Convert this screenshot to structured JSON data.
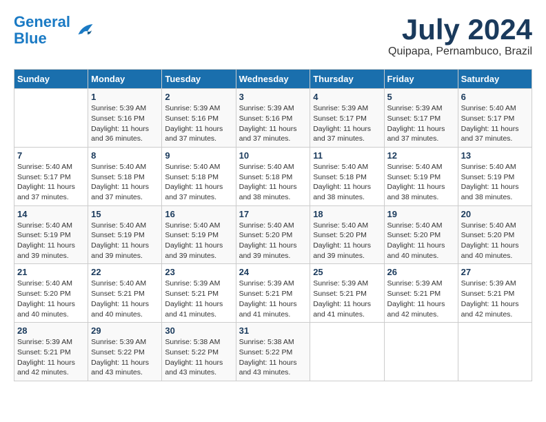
{
  "header": {
    "logo_line1": "General",
    "logo_line2": "Blue",
    "title": "July 2024",
    "subtitle": "Quipapa, Pernambuco, Brazil"
  },
  "days_of_week": [
    "Sunday",
    "Monday",
    "Tuesday",
    "Wednesday",
    "Thursday",
    "Friday",
    "Saturday"
  ],
  "weeks": [
    [
      {
        "day": "",
        "info": ""
      },
      {
        "day": "1",
        "info": "Sunrise: 5:39 AM\nSunset: 5:16 PM\nDaylight: 11 hours and 36 minutes."
      },
      {
        "day": "2",
        "info": "Sunrise: 5:39 AM\nSunset: 5:16 PM\nDaylight: 11 hours and 37 minutes."
      },
      {
        "day": "3",
        "info": "Sunrise: 5:39 AM\nSunset: 5:16 PM\nDaylight: 11 hours and 37 minutes."
      },
      {
        "day": "4",
        "info": "Sunrise: 5:39 AM\nSunset: 5:17 PM\nDaylight: 11 hours and 37 minutes."
      },
      {
        "day": "5",
        "info": "Sunrise: 5:39 AM\nSunset: 5:17 PM\nDaylight: 11 hours and 37 minutes."
      },
      {
        "day": "6",
        "info": "Sunrise: 5:40 AM\nSunset: 5:17 PM\nDaylight: 11 hours and 37 minutes."
      }
    ],
    [
      {
        "day": "7",
        "info": "Sunrise: 5:40 AM\nSunset: 5:17 PM\nDaylight: 11 hours and 37 minutes."
      },
      {
        "day": "8",
        "info": "Sunrise: 5:40 AM\nSunset: 5:18 PM\nDaylight: 11 hours and 37 minutes."
      },
      {
        "day": "9",
        "info": "Sunrise: 5:40 AM\nSunset: 5:18 PM\nDaylight: 11 hours and 37 minutes."
      },
      {
        "day": "10",
        "info": "Sunrise: 5:40 AM\nSunset: 5:18 PM\nDaylight: 11 hours and 38 minutes."
      },
      {
        "day": "11",
        "info": "Sunrise: 5:40 AM\nSunset: 5:18 PM\nDaylight: 11 hours and 38 minutes."
      },
      {
        "day": "12",
        "info": "Sunrise: 5:40 AM\nSunset: 5:19 PM\nDaylight: 11 hours and 38 minutes."
      },
      {
        "day": "13",
        "info": "Sunrise: 5:40 AM\nSunset: 5:19 PM\nDaylight: 11 hours and 38 minutes."
      }
    ],
    [
      {
        "day": "14",
        "info": "Sunrise: 5:40 AM\nSunset: 5:19 PM\nDaylight: 11 hours and 39 minutes."
      },
      {
        "day": "15",
        "info": "Sunrise: 5:40 AM\nSunset: 5:19 PM\nDaylight: 11 hours and 39 minutes."
      },
      {
        "day": "16",
        "info": "Sunrise: 5:40 AM\nSunset: 5:19 PM\nDaylight: 11 hours and 39 minutes."
      },
      {
        "day": "17",
        "info": "Sunrise: 5:40 AM\nSunset: 5:20 PM\nDaylight: 11 hours and 39 minutes."
      },
      {
        "day": "18",
        "info": "Sunrise: 5:40 AM\nSunset: 5:20 PM\nDaylight: 11 hours and 39 minutes."
      },
      {
        "day": "19",
        "info": "Sunrise: 5:40 AM\nSunset: 5:20 PM\nDaylight: 11 hours and 40 minutes."
      },
      {
        "day": "20",
        "info": "Sunrise: 5:40 AM\nSunset: 5:20 PM\nDaylight: 11 hours and 40 minutes."
      }
    ],
    [
      {
        "day": "21",
        "info": "Sunrise: 5:40 AM\nSunset: 5:20 PM\nDaylight: 11 hours and 40 minutes."
      },
      {
        "day": "22",
        "info": "Sunrise: 5:40 AM\nSunset: 5:21 PM\nDaylight: 11 hours and 40 minutes."
      },
      {
        "day": "23",
        "info": "Sunrise: 5:39 AM\nSunset: 5:21 PM\nDaylight: 11 hours and 41 minutes."
      },
      {
        "day": "24",
        "info": "Sunrise: 5:39 AM\nSunset: 5:21 PM\nDaylight: 11 hours and 41 minutes."
      },
      {
        "day": "25",
        "info": "Sunrise: 5:39 AM\nSunset: 5:21 PM\nDaylight: 11 hours and 41 minutes."
      },
      {
        "day": "26",
        "info": "Sunrise: 5:39 AM\nSunset: 5:21 PM\nDaylight: 11 hours and 42 minutes."
      },
      {
        "day": "27",
        "info": "Sunrise: 5:39 AM\nSunset: 5:21 PM\nDaylight: 11 hours and 42 minutes."
      }
    ],
    [
      {
        "day": "28",
        "info": "Sunrise: 5:39 AM\nSunset: 5:21 PM\nDaylight: 11 hours and 42 minutes."
      },
      {
        "day": "29",
        "info": "Sunrise: 5:39 AM\nSunset: 5:22 PM\nDaylight: 11 hours and 43 minutes."
      },
      {
        "day": "30",
        "info": "Sunrise: 5:38 AM\nSunset: 5:22 PM\nDaylight: 11 hours and 43 minutes."
      },
      {
        "day": "31",
        "info": "Sunrise: 5:38 AM\nSunset: 5:22 PM\nDaylight: 11 hours and 43 minutes."
      },
      {
        "day": "",
        "info": ""
      },
      {
        "day": "",
        "info": ""
      },
      {
        "day": "",
        "info": ""
      }
    ]
  ]
}
